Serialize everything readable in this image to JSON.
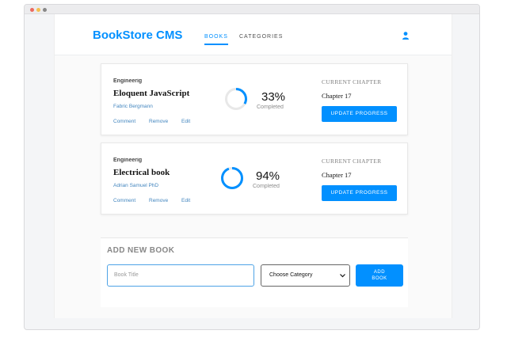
{
  "header": {
    "brand": "BookStore CMS",
    "nav": [
      "BOOKS",
      "CATEGORIES"
    ]
  },
  "books": [
    {
      "genre": "Engineerig",
      "title": "Eloquent JavaScript",
      "author": "Fabric Bergmann",
      "actions": [
        "Comment",
        "Remove",
        "Edit"
      ],
      "progress": 0.33,
      "percent_text": "33%",
      "completed_label": "Completed",
      "current_label": "CURRENT CHAPTER",
      "chapter": "Chapter 17",
      "update_label": "UPDATE PROGRESS"
    },
    {
      "genre": "Engineerig",
      "title": "Electrical book",
      "author": "Adrian Samuel PhD",
      "actions": [
        "Comment",
        "Remove",
        "Edit"
      ],
      "progress": 0.94,
      "percent_text": "94%",
      "completed_label": "Completed",
      "current_label": "CURRENT CHAPTER",
      "chapter": "Chapter 17",
      "update_label": "UPDATE PROGRESS"
    }
  ],
  "add_book": {
    "heading": "ADD NEW BOOK",
    "title_placeholder": "Book Title",
    "category_selected": "Choose Category",
    "button_label": "ADD BOOK"
  },
  "colors": {
    "accent": "#0290ff",
    "link": "#4386bf",
    "ring_track": "#e8e8e8"
  }
}
